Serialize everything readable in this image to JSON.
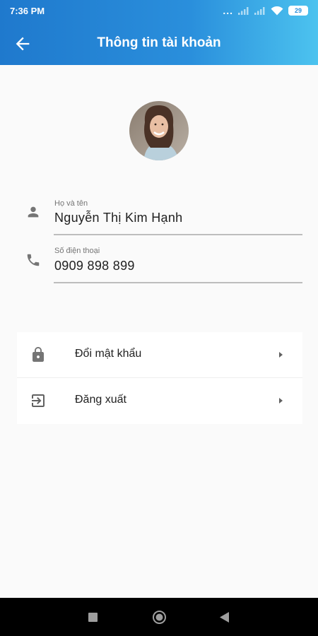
{
  "status_bar": {
    "time": "7:36 PM",
    "dots": "...",
    "battery": "29"
  },
  "app_bar": {
    "title": "Thông tin tài khoản",
    "back_icon": "arrow-left-icon"
  },
  "profile": {
    "avatar_icon": "avatar-photo"
  },
  "fields": {
    "name": {
      "label": "Họ và tên",
      "value": "Nguyễn Thị Kim Hạnh",
      "icon": "person-icon"
    },
    "phone": {
      "label": "Số điện thoại",
      "value": "0909 898 899",
      "icon": "phone-icon"
    }
  },
  "menu": {
    "items": [
      {
        "label": "Đổi mật khẩu",
        "icon": "lock-icon"
      },
      {
        "label": "Đăng xuất",
        "icon": "logout-icon"
      }
    ]
  },
  "nav_bar": {
    "buttons": [
      "recents-square-icon",
      "home-circle-icon",
      "back-triangle-icon"
    ]
  },
  "colors": {
    "header_start": "#1f79cd",
    "header_end": "#4cc3ef",
    "background": "#fafafa",
    "text": "#212121",
    "muted": "#757575"
  }
}
